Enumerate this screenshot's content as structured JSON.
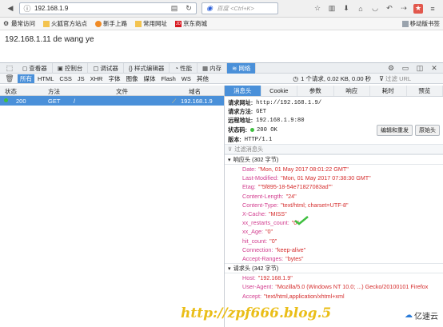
{
  "browser": {
    "url": "192.168.1.9",
    "search_placeholder": "百度 <Ctrl+K>"
  },
  "bookmarks": [
    {
      "label": "最常访问",
      "icon": "gear-icon"
    },
    {
      "label": "火狐官方站点",
      "icon": "firefox-icon"
    },
    {
      "label": "新手上路",
      "icon": "firefox-icon"
    },
    {
      "label": "常用网址",
      "icon": "folder-icon"
    },
    {
      "label": "京东商城",
      "icon": "jd-icon"
    }
  ],
  "mobile_bookmarks": "移动版书签",
  "page": {
    "content": "192.168.1.11 de wang ye"
  },
  "devtools": {
    "tabs": [
      {
        "label": "查看器",
        "icon": "inspector-icon"
      },
      {
        "label": "控制台",
        "icon": "console-icon"
      },
      {
        "label": "调试器",
        "icon": "debugger-icon"
      },
      {
        "label": "样式编辑器",
        "icon": "style-icon"
      },
      {
        "label": "性能",
        "icon": "performance-icon"
      },
      {
        "label": "内存",
        "icon": "memory-icon"
      },
      {
        "label": "网络",
        "icon": "network-icon"
      }
    ],
    "filters": [
      "所有",
      "HTML",
      "CSS",
      "JS",
      "XHR",
      "字体",
      "图像",
      "媒体",
      "Flash",
      "WS",
      "其他"
    ],
    "summary": "1 个请求, 0.02 KB, 0.00 秒",
    "filter_url": "过滤 URL",
    "columns": {
      "status": "状态",
      "method": "方法",
      "file": "文件",
      "domain": "域名"
    },
    "request": {
      "status": "200",
      "method": "GET",
      "file": "/",
      "domain": "192.168.1.9"
    }
  },
  "details": {
    "tabs": [
      "消息头",
      "Cookie",
      "参数",
      "响应",
      "耗时",
      "预览"
    ],
    "request_url_label": "请求网址:",
    "request_url": "http://192.168.1.9/",
    "method_label": "请求方法:",
    "method": "GET",
    "remote_label": "远程地址:",
    "remote": "192.168.1.9:80",
    "status_label": "状态码:",
    "status": "200 OK",
    "version_label": "版本:",
    "version": "HTTP/1.1",
    "edit_resend": "编辑和重发",
    "raw_headers": "原始头",
    "filter_headers": "过滤消息头",
    "response_section": "响应头 (302 字节)",
    "response_headers": [
      {
        "k": "Date:",
        "v": "\"Mon, 01 May 2017 08:01:22 GMT\""
      },
      {
        "k": "Last-Modified:",
        "v": "\"Mon, 01 May 2017 07:38:30 GMT\""
      },
      {
        "k": "Etag:",
        "v": "\"\"5f895-18-54e71827083ad\"\""
      },
      {
        "k": "Content-Length:",
        "v": "\"24\""
      },
      {
        "k": "Content-Type:",
        "v": "\"text/html; charset=UTF-8\""
      },
      {
        "k": "X-Cache:",
        "v": "\"MISS\""
      },
      {
        "k": "xx_restarts_count:",
        "v": "\"0\""
      },
      {
        "k": "xx_Age:",
        "v": "\"0\""
      },
      {
        "k": "hit_count:",
        "v": "\"0\""
      },
      {
        "k": "Connection:",
        "v": "\"keep-alive\""
      },
      {
        "k": "Accept-Ranges:",
        "v": "\"bytes\""
      }
    ],
    "request_section": "请求头 (342 字节)",
    "request_headers": [
      {
        "k": "Host:",
        "v": "\"192.168.1.9\""
      },
      {
        "k": "User-Agent:",
        "v": "\"Mozilla/5.0 (Windows NT 10.0; ...) Gecko/20100101 Firefox"
      },
      {
        "k": "Accept:",
        "v": "\"text/html,application/xhtml+xml"
      }
    ]
  },
  "watermark": "http://zpf666.blog.5",
  "brand": "亿速云",
  "colors": {
    "accent": "#4a90d9",
    "header_key": "#d23d8f",
    "header_value": "#d52c2c",
    "ok": "#3fbf3f"
  }
}
